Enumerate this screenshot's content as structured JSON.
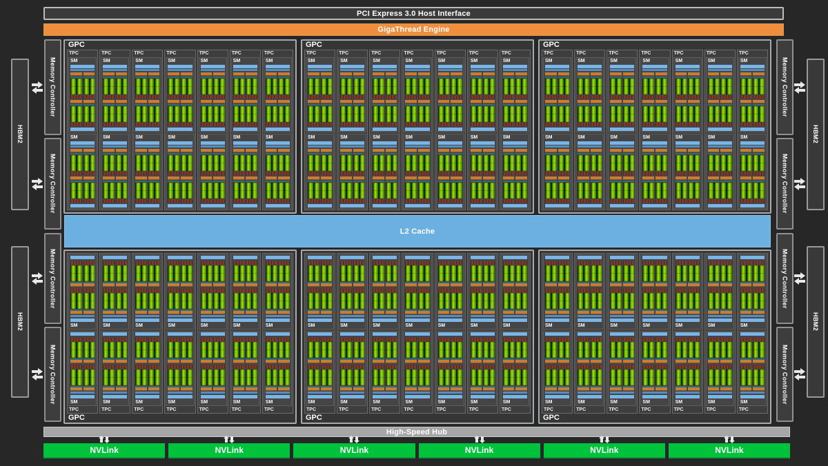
{
  "bars": {
    "pci": "PCI Express 3.0 Host Interface",
    "gigathread": "GigaThread Engine",
    "l2": "L2 Cache",
    "hub": "High-Speed Hub"
  },
  "labels": {
    "gpc": "GPC",
    "tpc": "TPC",
    "sm": "SM",
    "memory_controller": "Memory Controller",
    "hbm2": "HBM2",
    "nvlink": "NVLink"
  },
  "counts": {
    "gpc_rows": 2,
    "gpc_per_row": 3,
    "tpc_per_gpc": 7,
    "sm_per_tpc": 2,
    "sm_partitions_per_sm": 4,
    "nvlink": 6,
    "memory_controllers_per_side": 4,
    "hbm_stacks_per_side": 2
  },
  "colors": {
    "background": "#272727",
    "gigathread_orange": "#ef8e3d",
    "l2_blue": "#6bb0e0",
    "sm_blue_bar": "#7ab5e5",
    "sm_thin_blue_bar": "#528fc4",
    "partition_orange": "#c87c34",
    "core_green": "#64b203",
    "ldst_red": "#7d392b",
    "nvlink_green": "#00c33c",
    "hub_gray": "#a6a6a6"
  }
}
